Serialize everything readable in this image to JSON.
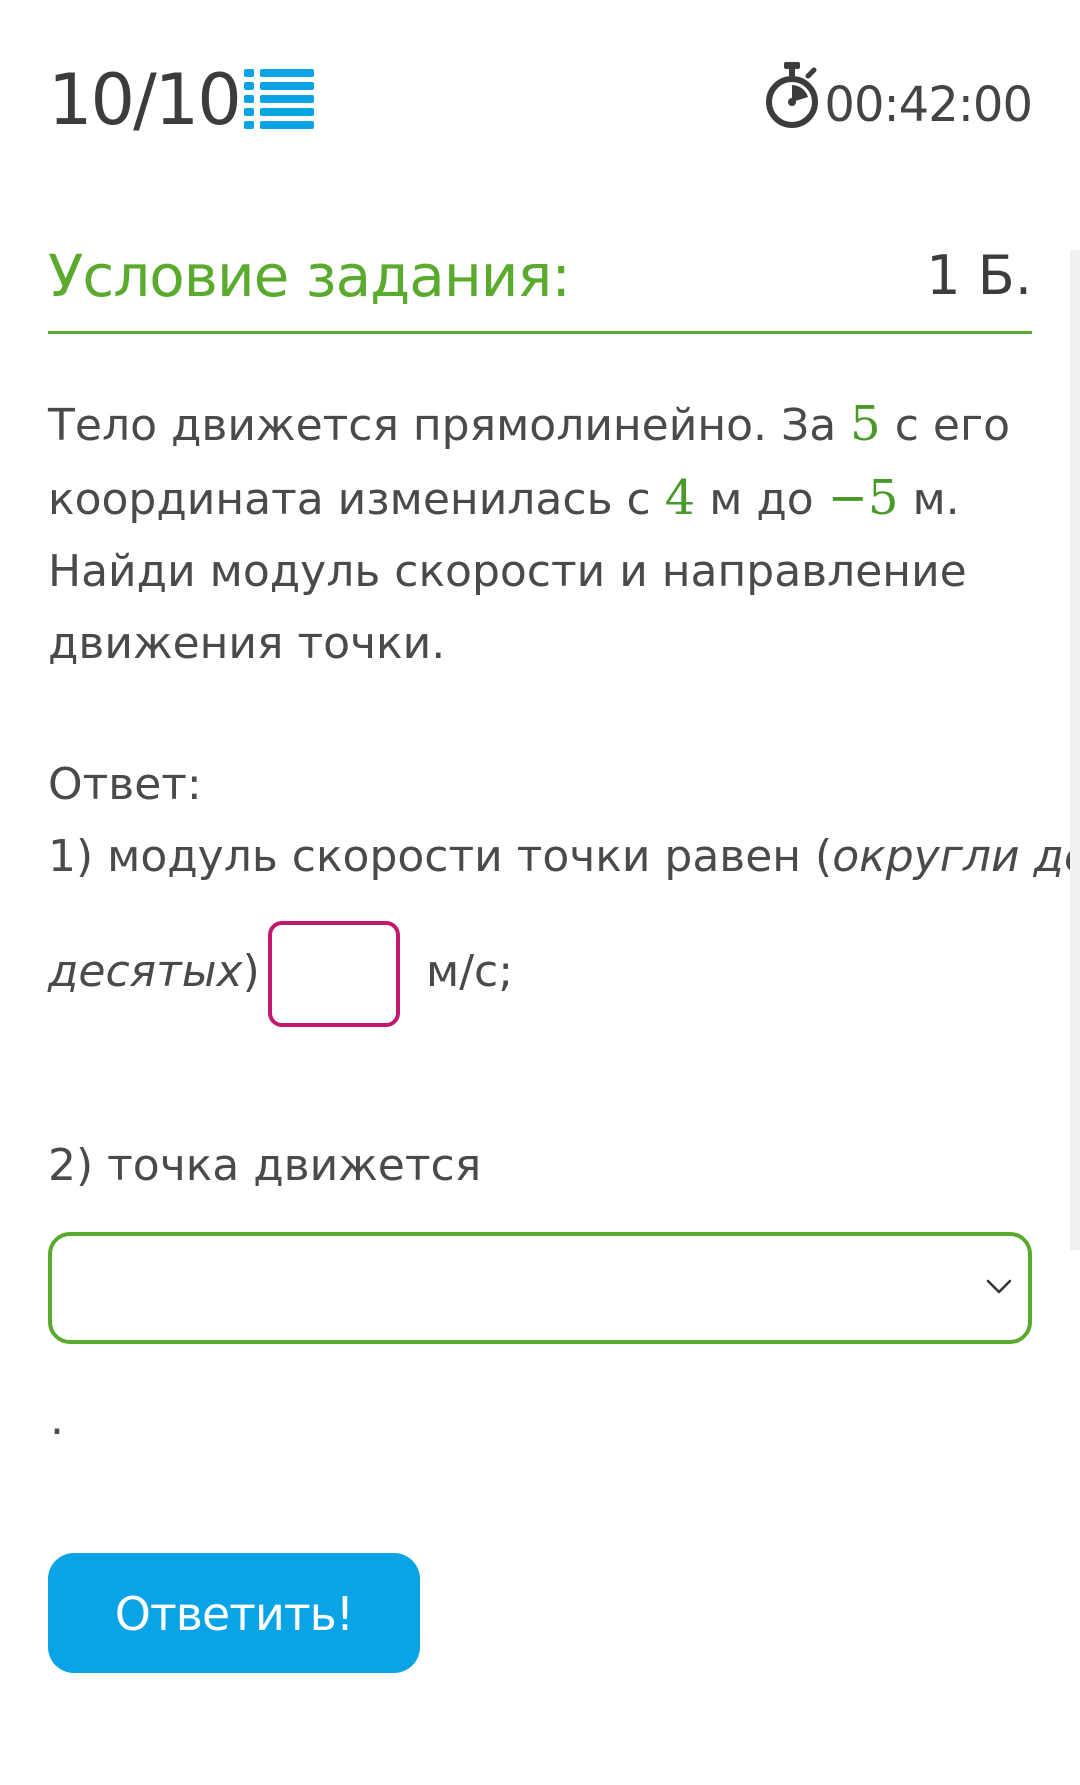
{
  "header": {
    "counter": "10/10",
    "timer": "00:42:00",
    "icons": {
      "list": "list-icon",
      "timer": "stopwatch-icon"
    }
  },
  "section": {
    "title": "Условие задания:",
    "points": "1 Б."
  },
  "problem": {
    "p1": "Тело движется прямолинейно. За ",
    "n1": "5",
    "p2": " с его координата изменилась с ",
    "n2": "4",
    "p3": " м до ",
    "n3": "−5",
    "p4": " м. Найди модуль скорости и направление движения точки."
  },
  "answer": {
    "label": "Ответ:",
    "q1_prefix": "1) модуль скорости точки равен (",
    "q1_hint_1": "округли до",
    "q1_hint_2": "десятых",
    "q1_close": ")",
    "q1_value": "",
    "q1_unit": "м/с;",
    "q2_label": "2) точка движется",
    "q2_selected": "",
    "trailing": "."
  },
  "submit": {
    "label": "Ответить!"
  },
  "colors": {
    "accent_green": "#5aab2d",
    "input_border": "#c2186e",
    "button_blue": "#0aa3e6",
    "icon_blue": "#0aa3e6",
    "text": "#4a4a4a"
  }
}
